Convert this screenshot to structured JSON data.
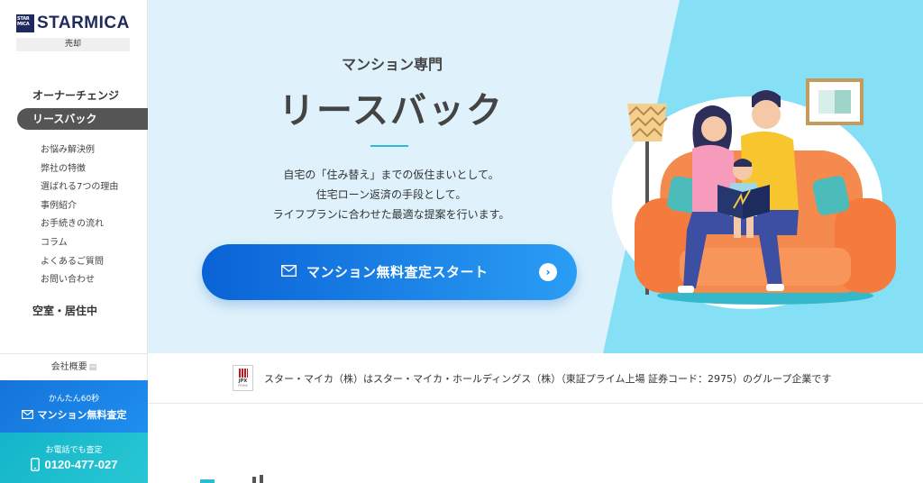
{
  "brand": {
    "logo_mark": "STAR MICA",
    "name": "STARMICA",
    "section": "売却"
  },
  "sidebar": {
    "primary_1": "オーナーチェンジ",
    "active": "リースバック",
    "sub_items": [
      "お悩み解決例",
      "弊社の特徴",
      "選ばれる7つの理由",
      "事例紹介",
      "お手続きの流れ",
      "コラム",
      "よくあるご質問",
      "お問い合わせ"
    ],
    "primary_2": "空室・居住中",
    "company": "会社概要",
    "cta_assess_small": "かんたん60秒",
    "cta_assess_big": "マンション無料査定",
    "cta_phone_small": "お電話でも査定",
    "cta_phone_number": "0120-477-027"
  },
  "hero": {
    "subtitle": "マンション専門",
    "title": "リースバック",
    "desc_1": "自宅の「住み替え」までの仮住まいとして。",
    "desc_2": "住宅ローン返済の手段として。",
    "desc_3": "ライフプランに合わせた最適な提案を行います。",
    "cta_label": "マンション無料査定スタート"
  },
  "group_bar": {
    "jpx_label": "JPX",
    "jpx_sub": "PRIME",
    "text": "スター・マイカ（株）はスター・マイカ・ホールディングス（株）（東証プライム上場 証券コード：2975）のグループ企業です"
  },
  "colors": {
    "brand_navy": "#1f2a5c",
    "cta_blue": "#1a78e0",
    "cta_teal": "#13b5c9",
    "hero_bg": "#dff2fb",
    "hero_accent": "#85e0f5"
  }
}
